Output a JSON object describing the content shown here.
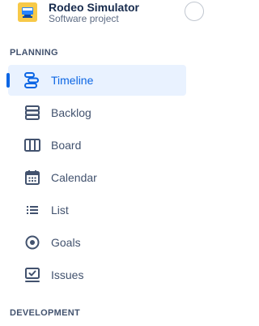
{
  "project": {
    "name": "Rodeo Simulator",
    "type": "Software project",
    "avatar_icon": "project-avatar-icon",
    "avatar_color": "#f7c948"
  },
  "sections": {
    "planning": "PLANNING",
    "development": "DEVELOPMENT"
  },
  "nav": {
    "selected": "Timeline",
    "accent_color": "#0c66e4",
    "items": [
      {
        "label": "Timeline",
        "icon": "timeline-icon"
      },
      {
        "label": "Backlog",
        "icon": "backlog-icon"
      },
      {
        "label": "Board",
        "icon": "board-icon"
      },
      {
        "label": "Calendar",
        "icon": "calendar-icon"
      },
      {
        "label": "List",
        "icon": "list-icon"
      },
      {
        "label": "Goals",
        "icon": "goals-icon"
      },
      {
        "label": "Issues",
        "icon": "issues-icon"
      }
    ]
  }
}
